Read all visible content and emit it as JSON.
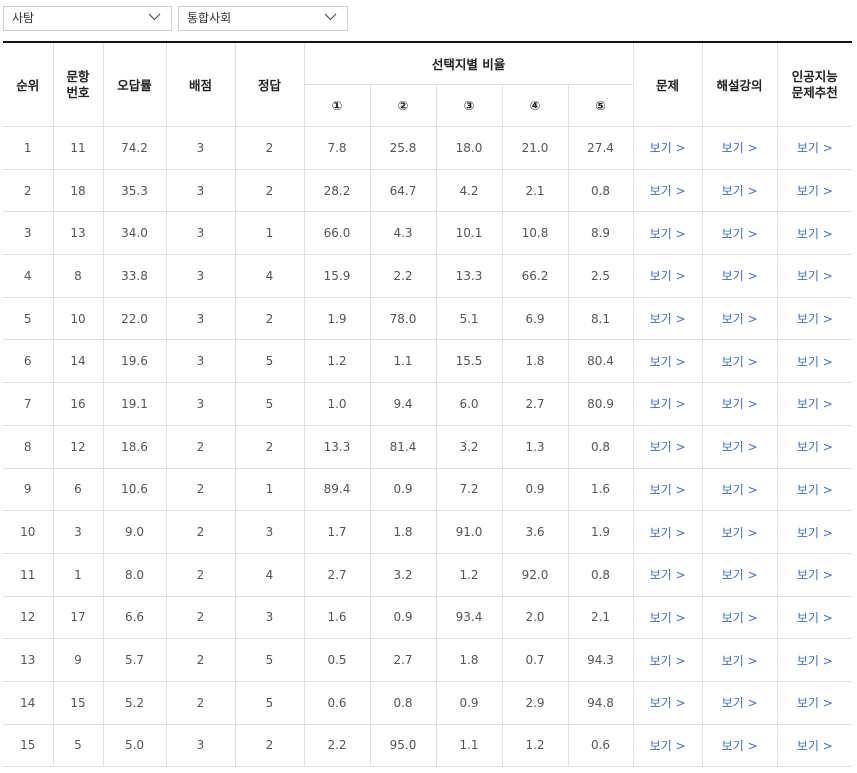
{
  "filters": {
    "subject_group": "사탐",
    "subject": "통합사회"
  },
  "table": {
    "headers": {
      "rank": "순위",
      "question_no": "문항\n번호",
      "wrong_rate": "오답률",
      "points": "배점",
      "answer": "정답",
      "choice_ratio": "선택지별 비율",
      "choices": [
        "①",
        "②",
        "③",
        "④",
        "⑤"
      ],
      "question": "문제",
      "lecture": "해설강의",
      "ai": "인공지능\n문제추천"
    },
    "link_label": "보기 >",
    "rows": [
      {
        "rank": "1",
        "no": "11",
        "wrong": "74.2",
        "points": "3",
        "answer": "2",
        "c": [
          "7.8",
          "25.8",
          "18.0",
          "21.0",
          "27.4"
        ]
      },
      {
        "rank": "2",
        "no": "18",
        "wrong": "35.3",
        "points": "3",
        "answer": "2",
        "c": [
          "28.2",
          "64.7",
          "4.2",
          "2.1",
          "0.8"
        ]
      },
      {
        "rank": "3",
        "no": "13",
        "wrong": "34.0",
        "points": "3",
        "answer": "1",
        "c": [
          "66.0",
          "4.3",
          "10.1",
          "10.8",
          "8.9"
        ]
      },
      {
        "rank": "4",
        "no": "8",
        "wrong": "33.8",
        "points": "3",
        "answer": "4",
        "c": [
          "15.9",
          "2.2",
          "13.3",
          "66.2",
          "2.5"
        ]
      },
      {
        "rank": "5",
        "no": "10",
        "wrong": "22.0",
        "points": "3",
        "answer": "2",
        "c": [
          "1.9",
          "78.0",
          "5.1",
          "6.9",
          "8.1"
        ]
      },
      {
        "rank": "6",
        "no": "14",
        "wrong": "19.6",
        "points": "3",
        "answer": "5",
        "c": [
          "1.2",
          "1.1",
          "15.5",
          "1.8",
          "80.4"
        ]
      },
      {
        "rank": "7",
        "no": "16",
        "wrong": "19.1",
        "points": "3",
        "answer": "5",
        "c": [
          "1.0",
          "9.4",
          "6.0",
          "2.7",
          "80.9"
        ]
      },
      {
        "rank": "8",
        "no": "12",
        "wrong": "18.6",
        "points": "2",
        "answer": "2",
        "c": [
          "13.3",
          "81.4",
          "3.2",
          "1.3",
          "0.8"
        ]
      },
      {
        "rank": "9",
        "no": "6",
        "wrong": "10.6",
        "points": "2",
        "answer": "1",
        "c": [
          "89.4",
          "0.9",
          "7.2",
          "0.9",
          "1.6"
        ]
      },
      {
        "rank": "10",
        "no": "3",
        "wrong": "9.0",
        "points": "2",
        "answer": "3",
        "c": [
          "1.7",
          "1.8",
          "91.0",
          "3.6",
          "1.9"
        ]
      },
      {
        "rank": "11",
        "no": "1",
        "wrong": "8.0",
        "points": "2",
        "answer": "4",
        "c": [
          "2.7",
          "3.2",
          "1.2",
          "92.0",
          "0.8"
        ]
      },
      {
        "rank": "12",
        "no": "17",
        "wrong": "6.6",
        "points": "2",
        "answer": "3",
        "c": [
          "1.6",
          "0.9",
          "93.4",
          "2.0",
          "2.1"
        ]
      },
      {
        "rank": "13",
        "no": "9",
        "wrong": "5.7",
        "points": "2",
        "answer": "5",
        "c": [
          "0.5",
          "2.7",
          "1.8",
          "0.7",
          "94.3"
        ]
      },
      {
        "rank": "14",
        "no": "15",
        "wrong": "5.2",
        "points": "2",
        "answer": "5",
        "c": [
          "0.6",
          "0.8",
          "0.9",
          "2.9",
          "94.8"
        ]
      },
      {
        "rank": "15",
        "no": "5",
        "wrong": "5.0",
        "points": "3",
        "answer": "2",
        "c": [
          "2.2",
          "95.0",
          "1.1",
          "1.2",
          "0.6"
        ]
      }
    ]
  },
  "colors": {
    "link": "#3a6fd1",
    "header_border": "#111111",
    "cell_border": "#e1e1e1"
  }
}
